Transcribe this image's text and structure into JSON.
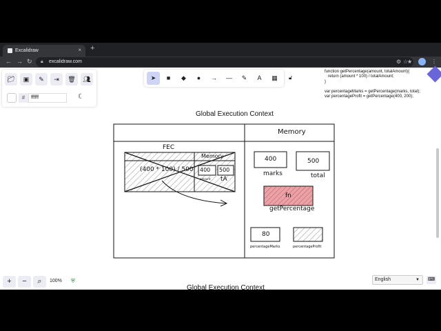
{
  "browser": {
    "tab_title": "Excalidraw",
    "tab_close": "×",
    "new_tab": "+",
    "url": "excalidraw.com",
    "back": "←",
    "forward": "→",
    "reload": "↻"
  },
  "left_panel": {
    "color_hash": "#",
    "color_value": "ffffff"
  },
  "code_text": "function getPercentage(amount, totalAmount){\n   return (amount * 100) / totalAmount;\n}\n\nvar percentageMarks = getPercentage(marks, total);\nvar percentageProfit = getPercentage(400, 200);",
  "diagram": {
    "title": "Global Execution Context",
    "memory_header": "Memory",
    "fec_label": "FEC",
    "fec_expression": "(400 * 100) / 500",
    "fec_memory_label": "Memory",
    "fec_values": [
      "400",
      "500"
    ],
    "fec_small_label": "amount",
    "fec_ta": "tA",
    "marks_value": "400",
    "marks_label": "marks",
    "total_value": "500",
    "total_label": "total",
    "fn_value": "fn",
    "fn_label": "getPercentage",
    "pm_value": "80",
    "pm_label": "percentageMarks",
    "pp_label": "percentageProfit",
    "fill_color": "#e8a2a8",
    "hatch_color": "#c55"
  },
  "footer": {
    "zoom": "100%",
    "zoom_in": "+",
    "zoom_out": "−",
    "language": "English",
    "partial_title": "Global Execution Context"
  }
}
